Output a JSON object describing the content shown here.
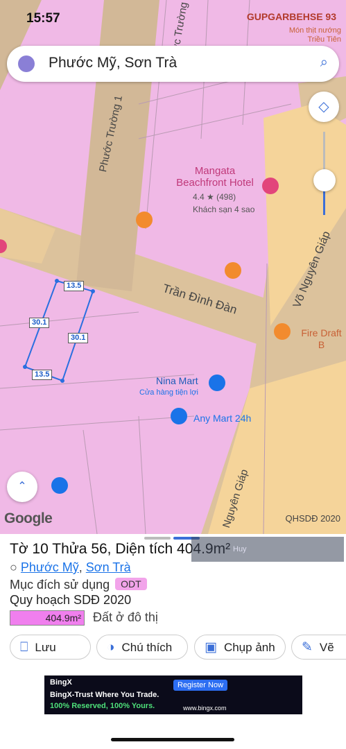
{
  "status": {
    "time": "15:57",
    "right_text": "GUPGARBEHSE",
    "battery": "93"
  },
  "search": {
    "query": "Phước Mỹ, Sơn Trà"
  },
  "map": {
    "poi_top_right": "Món thịt nướng\nTriều Tiên",
    "hotel_name": "Mangata\nBeachfront Hotel",
    "hotel_rating": "4.4 ★ (498)",
    "hotel_class": "Khách sạn 4 sao",
    "fire_draft": "Fire Draft B",
    "nina_mart": "Nina Mart",
    "nina_sub": "Cửa hàng tiện lợi",
    "any_mart": "Any Mart 24h",
    "streets": {
      "phuoc_truong": "Phước Trường 1",
      "tran_dinh_dan": "Trần Đình Đàn",
      "vo_nguyen_giap": "Võ Nguyên Giáp",
      "nguyen_giap": "Nguyên Giáp",
      "phuoc_truong_top": "Phước Trường"
    },
    "dims": [
      "13.5",
      "30.1",
      "30.1",
      "13.5"
    ],
    "google": "Google",
    "qhsdd": "QHSDĐ 2020"
  },
  "sheet": {
    "title": "Tờ 10 Thửa 56, Diện tích 404.9m²",
    "ward": "Phước Mỹ",
    "district": "Sơn Trà",
    "purpose_label": "Mục đích sử dụng",
    "purpose_code": "ODT",
    "plan_label": "Quy hoạch SDĐ 2020",
    "area_value": "404.9m²",
    "area_type": "Đất ở đô thị",
    "video_text": "Huy",
    "buttons": {
      "save": "Lưu",
      "legend": "Chú thích",
      "snapshot": "Chụp ảnh",
      "draw": "Vẽ"
    }
  },
  "ad": {
    "brand": "BingX",
    "headline": "BingX-Trust Where You Trade.",
    "line2": "100% Reserved, 100% Yours.",
    "cta": "Register Now",
    "url": "www.bingx.com"
  },
  "colors": {
    "accent": "#1a73e8",
    "zone_pink": "#f0b9e6",
    "road": "#d2b897"
  }
}
